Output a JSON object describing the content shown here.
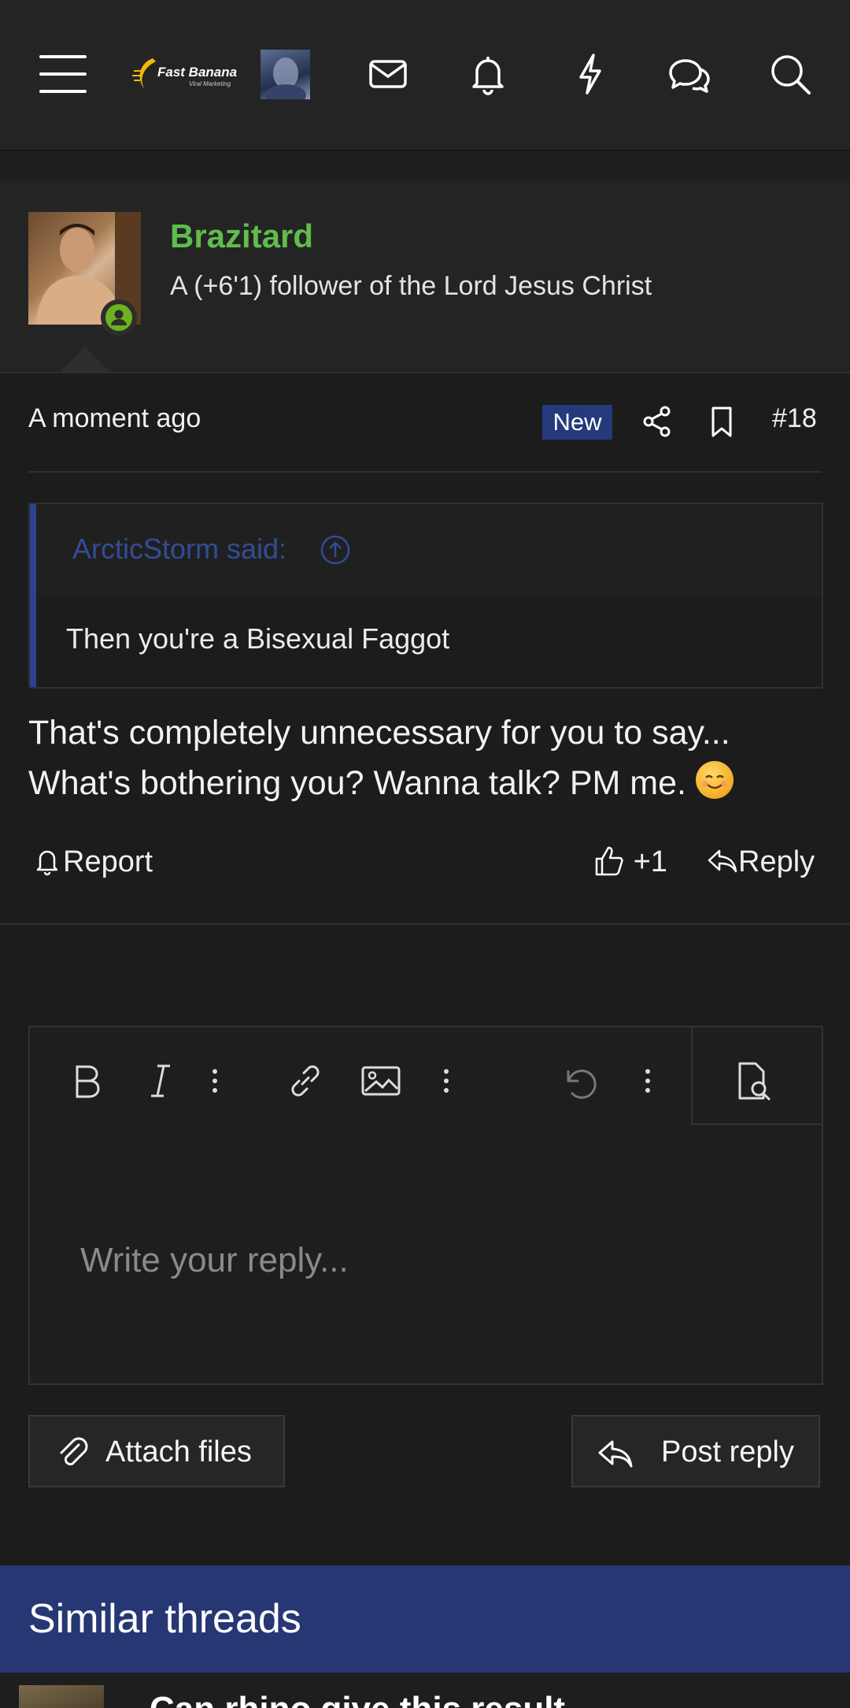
{
  "nav": {
    "logo_text": "Fast Banana",
    "logo_subtext": "Viral Marketing"
  },
  "post": {
    "username": "Brazitard",
    "user_title": "A (+6'1) follower of the Lord Jesus Christ",
    "time": "A moment ago",
    "badge": "New",
    "post_number": "#18",
    "quote_author": "ArcticStorm said:",
    "quote_text": "Then you're a Bisexual Faggot",
    "body_line1": "That's completely unnecessary for you to say...",
    "body_line2": "What's bothering you? Wanna talk? PM me.",
    "report_label": "Report",
    "like_count": "+1",
    "reply_label": "Reply"
  },
  "editor": {
    "placeholder": "Write your reply...",
    "attach_label": "Attach files",
    "post_reply_label": "Post reply"
  },
  "similar": {
    "title": "Similar threads",
    "first_thread_title": "Can rhino give this result"
  },
  "colors": {
    "username": "#5fbd4b",
    "accent": "#263774",
    "quote_bar": "#2a4291"
  }
}
